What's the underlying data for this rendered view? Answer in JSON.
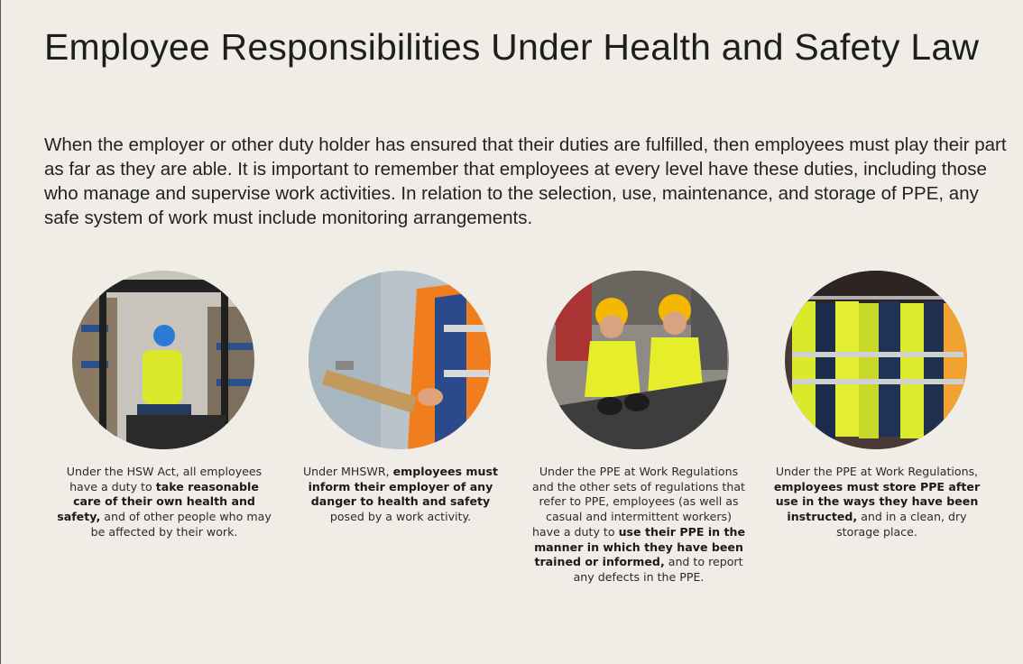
{
  "page": {
    "title": "Employee Responsibilities Under Health and Safety Law",
    "intro": "When the employer or other duty holder has ensured that their duties are fulfilled, then employees must play their part as far as they are able. It is important to remember that employees at every level have these duties, including those who manage and supervise work activities. In relation to the selection, use, maintenance, and storage of PPE, any safe system of work must include monitoring arrangements."
  },
  "cards": [
    {
      "image_icon": "forklift-operator-icon",
      "caption": [
        {
          "text": "Under the HSW Act, all employees have a duty to ",
          "bold": false
        },
        {
          "text": "take reasonable care of their own health and safety,",
          "bold": true
        },
        {
          "text": " and of other people who may be affected by their work.",
          "bold": false
        }
      ]
    },
    {
      "image_icon": "clipboard-inspector-icon",
      "caption": [
        {
          "text": "Under MHSWR, ",
          "bold": false
        },
        {
          "text": "employees must inform their employer of any danger to health and safety",
          "bold": true
        },
        {
          "text": " posed by a work activity.",
          "bold": false
        }
      ]
    },
    {
      "image_icon": "workers-hard-hats-icon",
      "caption": [
        {
          "text": "Under the PPE at Work Regulations and the other sets of regulations that refer to PPE, employees (as well as casual and intermittent workers) have a duty to ",
          "bold": false
        },
        {
          "text": "use their PPE in the manner in which they have been trained or informed,",
          "bold": true
        },
        {
          "text": " and to report any defects in the PPE.",
          "bold": false
        }
      ]
    },
    {
      "image_icon": "hi-vis-clothing-rack-icon",
      "caption": [
        {
          "text": "Under the PPE at Work Regulations, ",
          "bold": false
        },
        {
          "text": "employees must store PPE after use in the ways they have been instructed,",
          "bold": true
        },
        {
          "text": " and in a clean, dry storage place.",
          "bold": false
        }
      ]
    }
  ]
}
